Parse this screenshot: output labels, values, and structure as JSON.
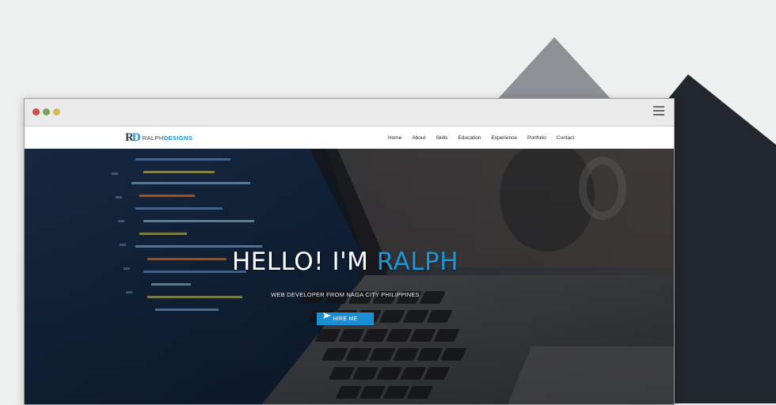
{
  "colors": {
    "page_bg": "#eeefef",
    "triangle_gray": "#8d9095",
    "triangle_dark": "#22262d",
    "accent": "#1f96d8",
    "dot_red": "#d34b4b",
    "dot_green": "#7aa35a",
    "dot_yellow": "#d8b84a"
  },
  "browser": {
    "menu_icon": "hamburger-icon"
  },
  "logo": {
    "mark": "RD",
    "name_light": "RALPH",
    "name_bold": "DESIGNS"
  },
  "nav": {
    "items": [
      "Home",
      "About",
      "Skills",
      "Education",
      "Experience",
      "Portfolio",
      "Contact"
    ]
  },
  "hero": {
    "greeting": "HELLO! I'M ",
    "name": "RALPH",
    "subtitle": "WEB DEVELOPER FROM NAGA CITY PHILIPPINES",
    "cta_label": "HIRE ME",
    "cta_icon": "paper-plane-icon",
    "background": "laptop-code-photo"
  }
}
